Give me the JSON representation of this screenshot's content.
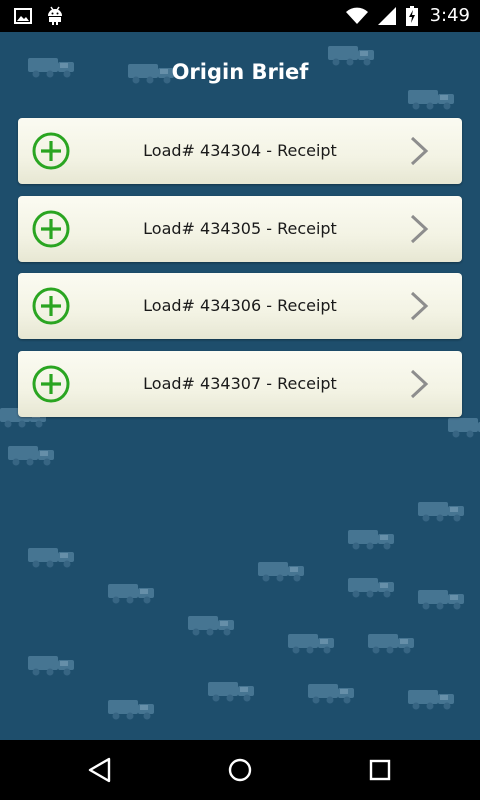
{
  "status_bar": {
    "time": "3:49",
    "icons": [
      "image-icon",
      "android-icon",
      "wifi-icon",
      "signal-icon",
      "battery-charging-icon"
    ]
  },
  "screen": {
    "title": "Origin Brief"
  },
  "loads": [
    {
      "label": "Load# 434304 - Receipt"
    },
    {
      "label": "Load# 434305 - Receipt"
    },
    {
      "label": "Load# 434306 - Receipt"
    },
    {
      "label": "Load# 434307 - Receipt"
    }
  ],
  "colors": {
    "background": "#1e4e6c",
    "accent_green": "#2aa521",
    "chevron": "#8d8d8d",
    "item_bg": "#f3f3e4"
  },
  "nav_bar": {
    "icons": [
      "back-icon",
      "home-icon",
      "recents-icon"
    ]
  }
}
